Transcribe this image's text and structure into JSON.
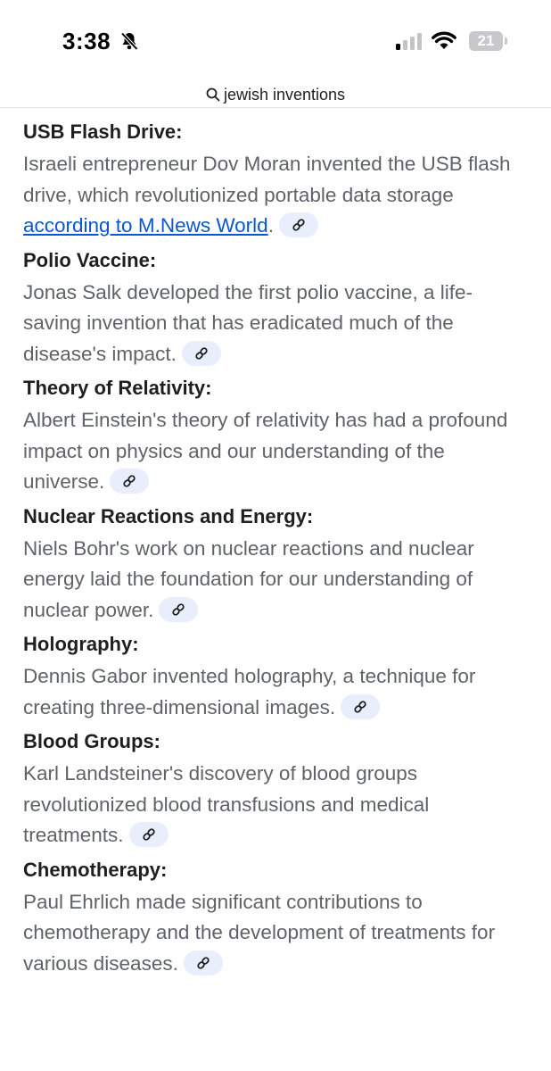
{
  "status_bar": {
    "time": "3:38",
    "battery": "21",
    "battery_level": 0.21,
    "icons": [
      "bell-slash-icon",
      "cellular-signal-icon",
      "wifi-icon",
      "battery-icon"
    ]
  },
  "search": {
    "query": "jewish inventions"
  },
  "colors": {
    "link": "#0b57d0",
    "chip_bg": "#e8eefb",
    "body_text": "#5f6368",
    "title_text": "#1f1f1f"
  },
  "items": [
    {
      "title": "USB Flash Drive:",
      "body": "Israeli entrepreneur Dov Moran invented the USB flash drive, which revolutionized portable data storage ",
      "link": "according to M.News World",
      "tail": "."
    },
    {
      "title": "Polio Vaccine:",
      "body": "Jonas Salk developed the first polio vaccine, a life-saving invention that has eradicated much of the disease's impact."
    },
    {
      "title": "Theory of Relativity:",
      "body": "Albert Einstein's theory of relativity has had a profound impact on physics and our understanding of the universe."
    },
    {
      "title": "Nuclear Reactions and Energy:",
      "body": "Niels Bohr's work on nuclear reactions and nuclear energy laid the foundation for our understanding of nuclear power."
    },
    {
      "title": "Holography:",
      "body": "Dennis Gabor invented holography, a technique for creating three-dimensional images."
    },
    {
      "title": "Blood Groups:",
      "body": "Karl Landsteiner's discovery of blood groups revolutionized blood transfusions and medical treatments."
    },
    {
      "title": "Chemotherapy:",
      "body": "Paul Ehrlich made significant contributions to chemotherapy and the development of treatments for various diseases."
    }
  ]
}
